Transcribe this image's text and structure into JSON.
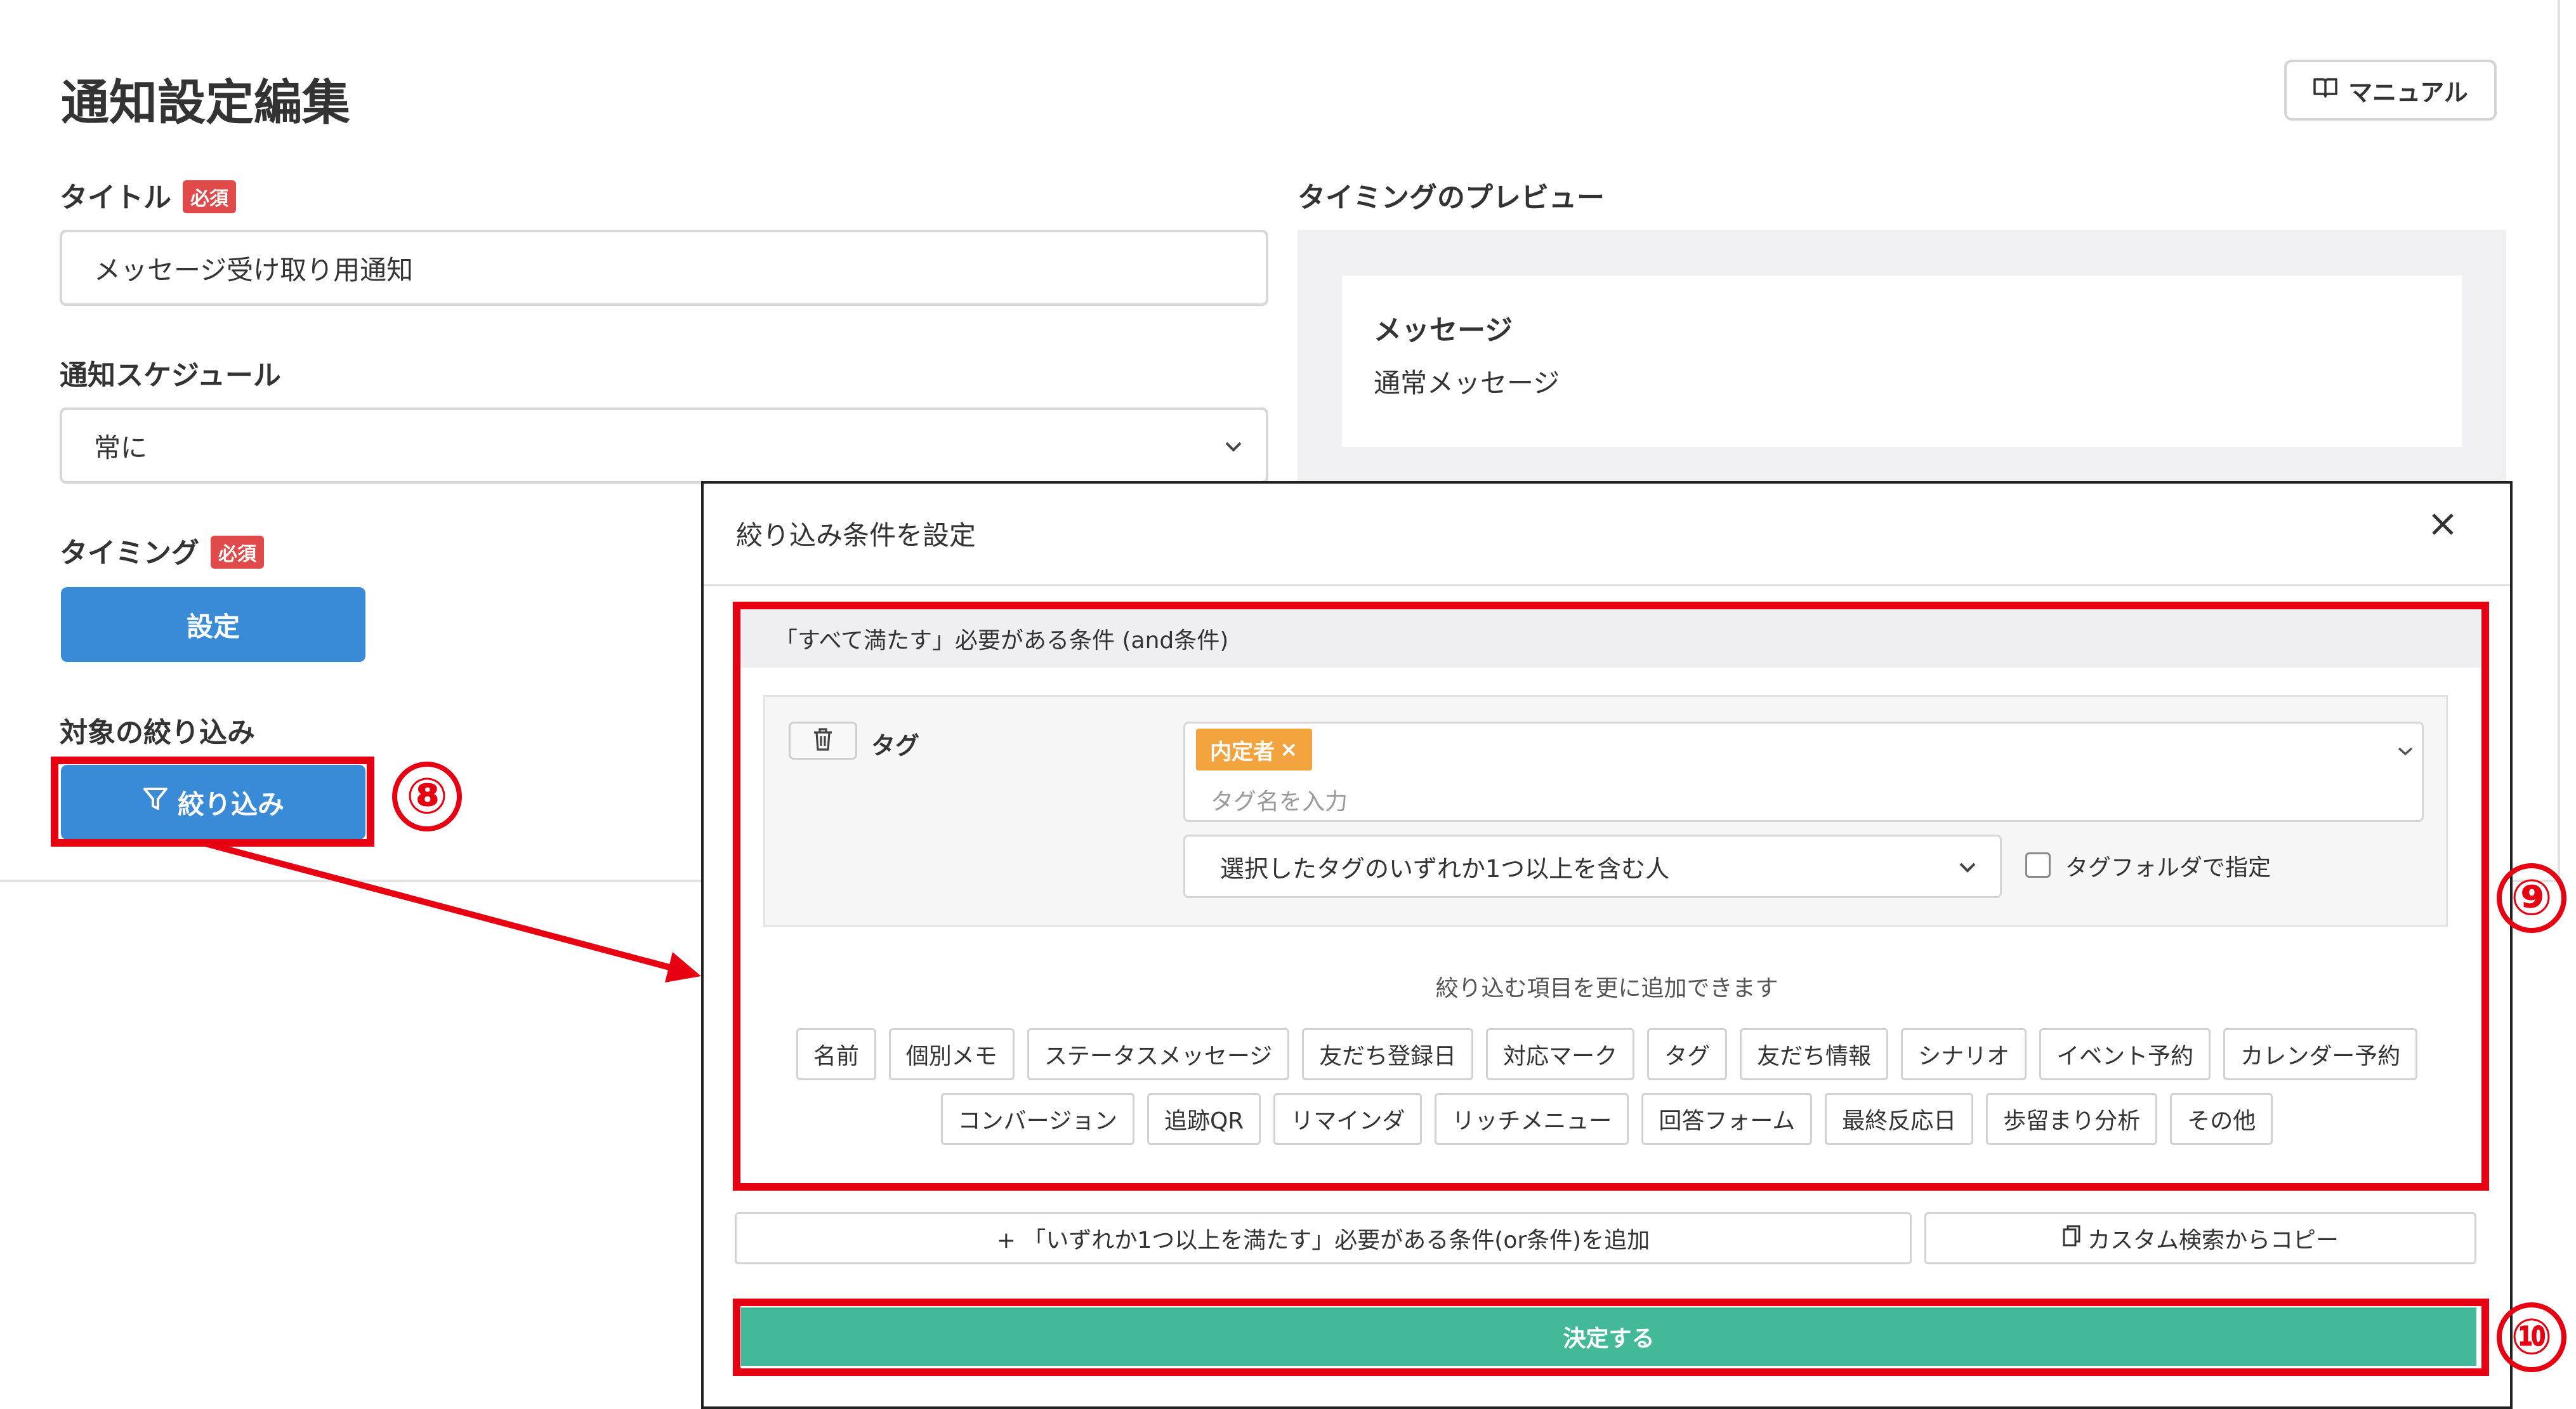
{
  "page": {
    "title": "通知設定編集",
    "manual_label": "マニュアル",
    "title_field": {
      "label": "タイトル",
      "required": "必須",
      "value": "メッセージ受け取り用通知"
    },
    "schedule_field": {
      "label": "通知スケジュール",
      "value": "常に"
    },
    "timing_field": {
      "label": "タイミング",
      "required": "必須",
      "button": "設定"
    },
    "filter_field": {
      "label": "対象の絞り込み",
      "button": "絞り込み"
    },
    "preview": {
      "label": "タイミングのプレビュー",
      "heading": "メッセージ",
      "text": "通常メッセージ"
    }
  },
  "modal": {
    "title": "絞り込み条件を設定",
    "and_header": "「すべて満たす」必要がある条件 (and条件)",
    "condition": {
      "label": "タグ",
      "chip": "内定者",
      "chip_remove": "×",
      "placeholder": "タグ名を入力",
      "match_mode": "選択したタグのいずれか1つ以上を含む人",
      "folder_label": "タグフォルダで指定"
    },
    "hint": "絞り込む項目を更に追加できます",
    "items_row1": [
      "名前",
      "個別メモ",
      "ステータスメッセージ",
      "友だち登録日",
      "対応マーク",
      "タグ",
      "友だち情報",
      "シナリオ",
      "イベント予約",
      "カレンダー予約"
    ],
    "items_row2": [
      "コンバージョン",
      "追跡QR",
      "リマインダ",
      "リッチメニュー",
      "回答フォーム",
      "最終反応日",
      "歩留まり分析",
      "その他"
    ],
    "or_button": "+ 「いずれか1つ以上を満たす」必要がある条件(or条件)を追加",
    "copy_button": "カスタム検索からコピー",
    "submit": "決定する"
  },
  "annotations": {
    "step8": "⑧",
    "step9": "⑨",
    "step10": "⑩"
  },
  "colors": {
    "primary_blue": "#3a8bd7",
    "submit_green": "#43b99a",
    "required_red": "#e14a4a",
    "chip_orange": "#f3a33e",
    "annotation_red": "#e60012"
  }
}
